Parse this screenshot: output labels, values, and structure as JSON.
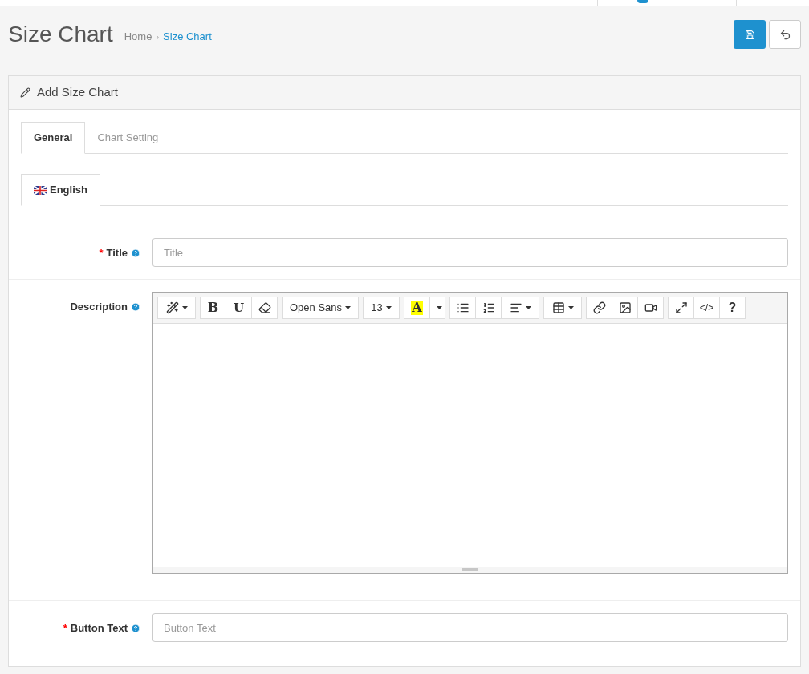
{
  "header": {
    "title": "Size Chart",
    "separator": "›",
    "breadcrumb": [
      {
        "label": "Home",
        "selected": false
      },
      {
        "label": "Size Chart",
        "selected": true
      }
    ]
  },
  "panel": {
    "title": "Add Size Chart"
  },
  "tabs": [
    {
      "label": "General",
      "selected": true
    },
    {
      "label": "Chart Setting",
      "selected": false
    }
  ],
  "language_tabs": [
    {
      "label": "English",
      "selected": true
    }
  ],
  "required_mark": "*",
  "fields": [
    {
      "kind": "input",
      "label": "Title",
      "required": true,
      "placeholder": "Title"
    },
    {
      "kind": "editor",
      "label": "Description",
      "required": false
    },
    {
      "kind": "input",
      "label": "Button Text",
      "required": true,
      "placeholder": "Button Text"
    }
  ],
  "editor_toolbar": {
    "bold": "B",
    "underline": "U",
    "font": "Open Sans",
    "font_size": "13",
    "highlight_letter": "A",
    "code": "</>",
    "help": "?"
  }
}
